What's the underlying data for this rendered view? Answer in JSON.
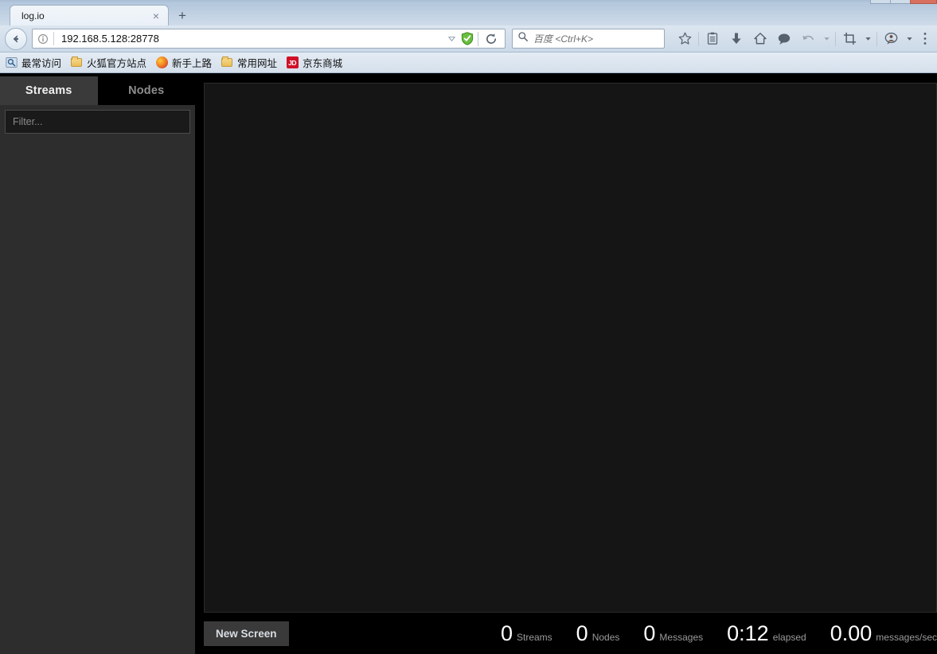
{
  "browser": {
    "tab": {
      "title": "log.io",
      "close_label": "×"
    },
    "new_tab_label": "+",
    "nav": {
      "back_icon": "back-arrow-icon",
      "identity_icon": "info-icon",
      "url": "192.168.5.128:28778",
      "dropdown_icon": "chevron-down-icon",
      "shield_icon": "adblock-shield-icon",
      "reload_icon": "reload-icon"
    },
    "search": {
      "placeholder": "百度 <Ctrl+K>",
      "icon": "search-icon"
    },
    "toolbar_icons": [
      "bookmark-star-icon",
      "library-icon",
      "downloads-icon",
      "home-icon",
      "chat-bubble-icon",
      "undo-icon",
      "undo-dropdown-icon",
      "screenshot-crop-icon",
      "screenshot-dropdown-icon",
      "account-bubble-icon",
      "account-dropdown-icon",
      "menu-hamburger-icon"
    ],
    "bookmarks": [
      {
        "label": "最常访问",
        "icon": "most-visited-icon"
      },
      {
        "label": "火狐官方站点",
        "icon": "folder-icon"
      },
      {
        "label": "新手上路",
        "icon": "firefox-icon"
      },
      {
        "label": "常用网址",
        "icon": "folder-icon"
      },
      {
        "label": "京东商城",
        "icon": "jd-icon"
      }
    ],
    "window_controls": {
      "minimize_label": "–",
      "maximize_label": "□",
      "close_label": "×"
    }
  },
  "app": {
    "tabs": [
      {
        "label": "Streams",
        "active": true
      },
      {
        "label": "Nodes",
        "active": false
      }
    ],
    "filter": {
      "placeholder": "Filter...",
      "value": ""
    },
    "new_screen_button": "New Screen",
    "stats": [
      {
        "value": "0",
        "label": "Streams"
      },
      {
        "value": "0",
        "label": "Nodes"
      },
      {
        "value": "0",
        "label": "Messages"
      },
      {
        "value": "0:12",
        "label": "elapsed"
      },
      {
        "value": "0.00",
        "label": "messages/sec"
      }
    ],
    "colors": {
      "sidebar_bg": "#2d2d2d",
      "screen_bg": "#151515",
      "active_tab_bg": "#3a3a3a",
      "button_bg": "#3a3a3a",
      "stat_value": "#ffffff",
      "stat_label": "#9a9a9a"
    }
  }
}
